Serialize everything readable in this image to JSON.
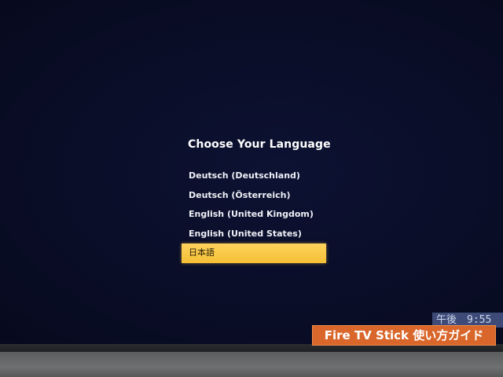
{
  "screen": {
    "title": "Choose Your Language",
    "languages": [
      {
        "label": "Deutsch (Deutschland)",
        "selected": false
      },
      {
        "label": "Deutsch (Österreich)",
        "selected": false
      },
      {
        "label": "English (United Kingdom)",
        "selected": false
      },
      {
        "label": "English (United States)",
        "selected": false
      },
      {
        "label": "日本語",
        "selected": true
      }
    ],
    "selected_language": "日本語",
    "highlight_color": "#f5c33e",
    "background_color": "#0a0e29"
  },
  "overlay": {
    "clock_text": "午後　9:55",
    "watermark_text": "Fire TV Stick 使い方ガイド",
    "watermark_color": "#d9662a"
  }
}
